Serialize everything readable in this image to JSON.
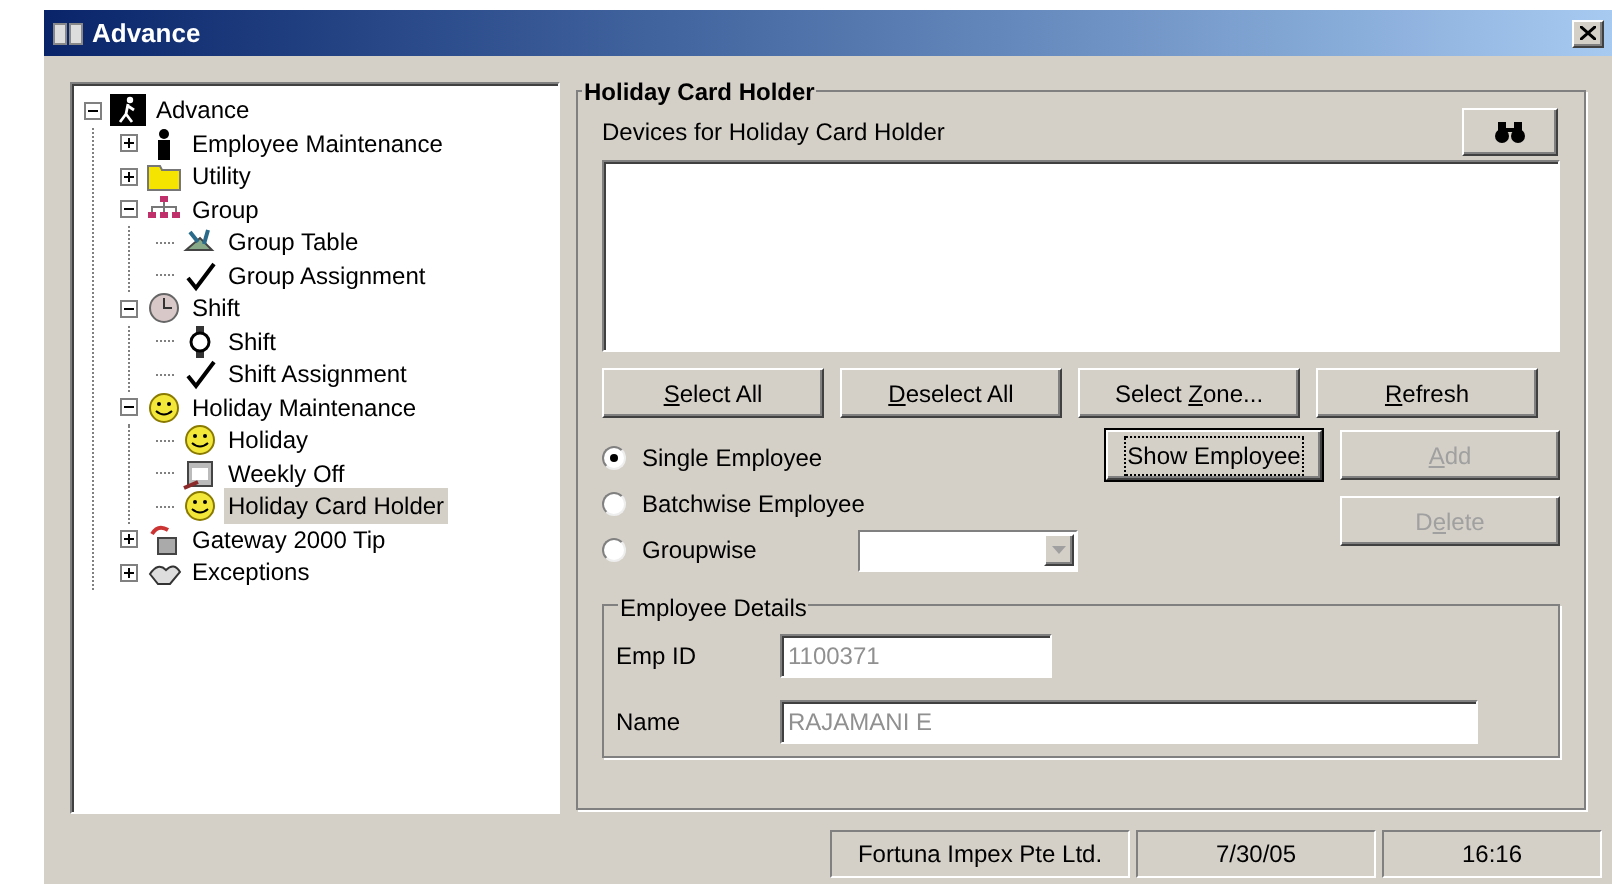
{
  "window": {
    "title": "Advance"
  },
  "tree": [
    {
      "label": "Advance",
      "kind": "runner",
      "expanded": true,
      "selected": false,
      "children": [
        {
          "label": "Employee Maintenance",
          "kind": "person",
          "expanded": false,
          "selected": false
        },
        {
          "label": "Utility",
          "kind": "folder",
          "expanded": false,
          "selected": false
        },
        {
          "label": "Group",
          "kind": "org",
          "expanded": true,
          "selected": false,
          "children": [
            {
              "label": "Group Table",
              "kind": "tools",
              "selected": false
            },
            {
              "label": "Group Assignment",
              "kind": "check",
              "selected": false
            }
          ]
        },
        {
          "label": "Shift",
          "kind": "clock",
          "expanded": true,
          "selected": false,
          "children": [
            {
              "label": "Shift",
              "kind": "watch",
              "selected": false
            },
            {
              "label": "Shift Assignment",
              "kind": "check",
              "selected": false
            }
          ]
        },
        {
          "label": "Holiday Maintenance",
          "kind": "smiley",
          "expanded": true,
          "selected": false,
          "children": [
            {
              "label": "Holiday",
              "kind": "smiley",
              "selected": false
            },
            {
              "label": "Weekly Off",
              "kind": "calendar",
              "selected": false
            },
            {
              "label": "Holiday Card Holder",
              "kind": "smiley",
              "selected": true
            }
          ]
        },
        {
          "label": "Gateway 2000 Tip",
          "kind": "phone",
          "expanded": false,
          "selected": false
        },
        {
          "label": "Exceptions",
          "kind": "hands",
          "expanded": false,
          "selected": false
        }
      ]
    }
  ],
  "group": {
    "title": "Holiday Card Holder",
    "devices_label": "Devices for Holiday Card Holder"
  },
  "buttons_row": [
    {
      "key": "S",
      "rest": "elect All",
      "disabled": false,
      "focused": false
    },
    {
      "key": "D",
      "rest": "eselect All",
      "disabled": false,
      "focused": false
    },
    {
      "before": "Select ",
      "key": "Z",
      "rest": "one...",
      "disabled": false,
      "focused": false
    },
    {
      "key": "R",
      "rest": "efresh",
      "disabled": false,
      "focused": false
    }
  ],
  "options": [
    {
      "label": "Single Employee",
      "selected": true
    },
    {
      "label": "Batchwise Employee",
      "selected": false
    },
    {
      "label": "Groupwise",
      "selected": false
    }
  ],
  "side_buttons": [
    {
      "before": "Show Employee",
      "disabled": false,
      "focused": true
    },
    {
      "key": "A",
      "rest": "dd",
      "disabled": true,
      "focused": false
    },
    {
      "before": "D",
      "key": "e",
      "rest": "lete",
      "disabled": true,
      "focused": false
    }
  ],
  "employee_details": {
    "title": "Employee Details",
    "fields": [
      {
        "label": "Emp ID",
        "value": "1100371"
      },
      {
        "label": "Name",
        "value": "RAJAMANI E"
      }
    ]
  },
  "status_bar": [
    "Fortuna Impex Pte Ltd.",
    "7/30/05",
    "16:16"
  ]
}
